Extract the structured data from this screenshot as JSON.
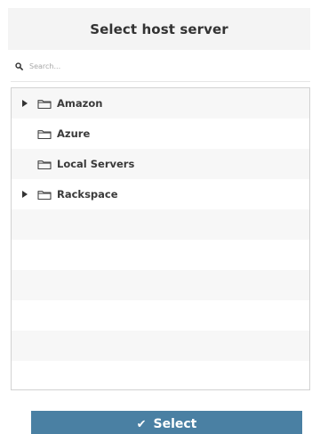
{
  "dialog": {
    "title": "Select host server"
  },
  "search": {
    "placeholder": "Search...",
    "icon": "search-icon"
  },
  "tree": {
    "items": [
      {
        "label": "Amazon",
        "expandable": true,
        "icon": "folder-icon"
      },
      {
        "label": "Azure",
        "expandable": false,
        "icon": "folder-icon"
      },
      {
        "label": "Local Servers",
        "expandable": false,
        "icon": "folder-icon"
      },
      {
        "label": "Rackspace",
        "expandable": true,
        "icon": "folder-icon"
      }
    ]
  },
  "footer": {
    "select_label": "Select",
    "select_icon": "check-icon"
  },
  "colors": {
    "header_bg": "#f4f4f4",
    "button_bg": "#4a80a3",
    "row_alt_bg": "#f7f7f7",
    "text": "#3a3a3a"
  }
}
